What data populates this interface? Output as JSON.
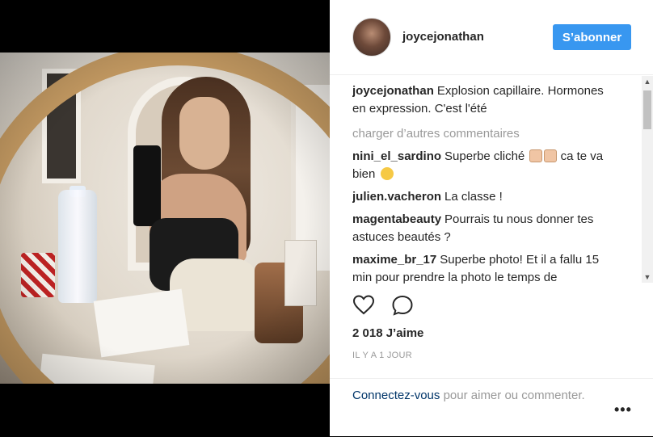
{
  "post": {
    "username": "joycejonathan",
    "follow_label": "S’abonner"
  },
  "caption": {
    "username": "joycejonathan",
    "text": "Explosion capillaire. Hormones en expression. C'est l'été"
  },
  "load_more_label": "charger d’autres commentaires",
  "comments": [
    {
      "username": "nini_el_sardino",
      "text": "Superbe cliché",
      "text_after": "ca te va bien",
      "emojis": [
        "thumbs-up",
        "thumbs-up"
      ],
      "emoji_end": "wink"
    },
    {
      "username": "julien.vacheron",
      "text": "La classe !"
    },
    {
      "username": "magentabeauty",
      "text": "Pourrais tu nous donner tes astuces beautés ?"
    },
    {
      "username": "maxime_br_17",
      "text": "Superbe photo! Et il a fallu 15 min pour prendre la photo le temps de"
    }
  ],
  "likes": "2 018 J’aime",
  "timestamp": "IL Y A 1 JOUR",
  "footer": {
    "login_link": "Connectez-vous",
    "rest": " pour aimer ou commenter.",
    "more": "•••"
  },
  "colors": {
    "follow_button": "#3897f0",
    "text": "#262626",
    "muted": "#999999",
    "link": "#003569"
  }
}
